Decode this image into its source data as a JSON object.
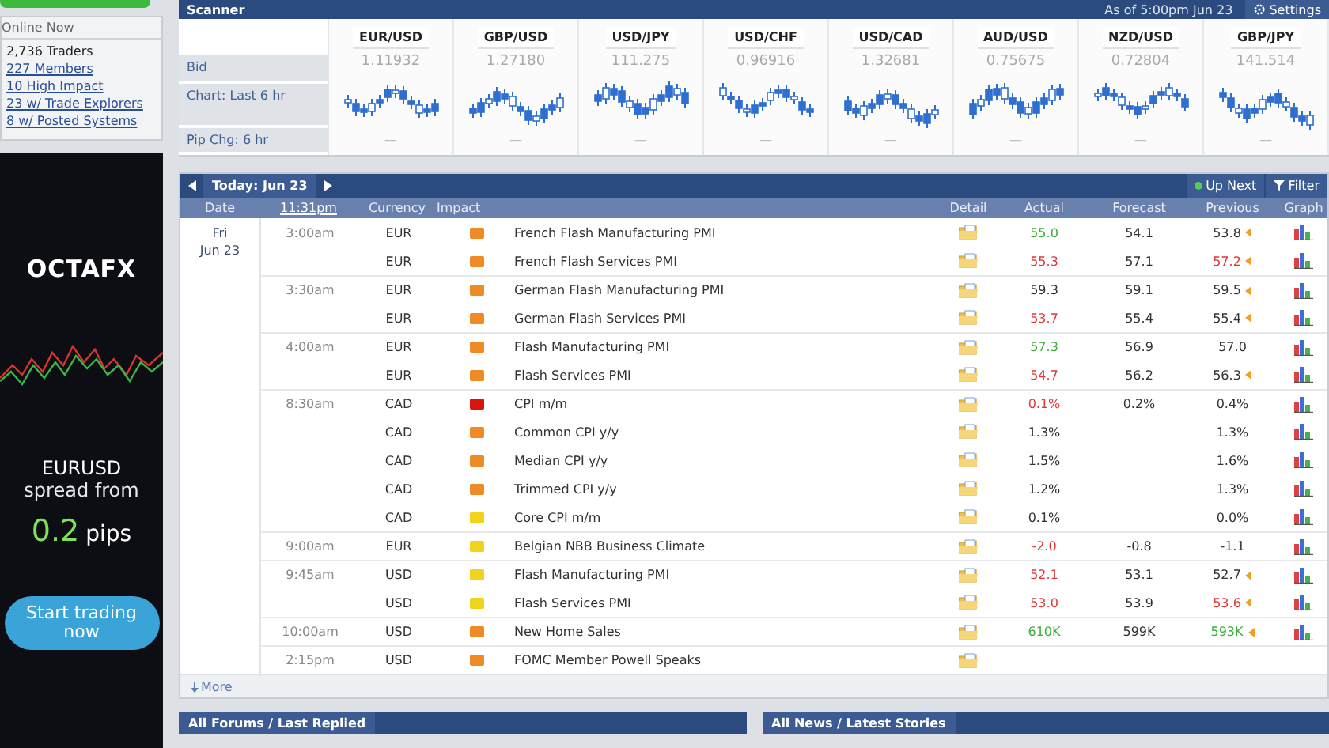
{
  "online_now": {
    "title": "Online Now",
    "items": [
      {
        "kind": "text",
        "label": "2,736 Traders"
      },
      {
        "kind": "link",
        "label": "227 Members"
      },
      {
        "kind": "link",
        "label": "10 High Impact"
      },
      {
        "kind": "link",
        "label": "23 w/ Trade Explorers"
      },
      {
        "kind": "link",
        "label": "8 w/ Posted Systems"
      }
    ]
  },
  "ad": {
    "logo": "OCTAFX",
    "pair": "EURUSD",
    "line": "spread from",
    "value": "0.2",
    "unit": "pips",
    "button": "Start trading now"
  },
  "scanner": {
    "title": "Scanner",
    "as_of": "As of 5:00pm Jun 23",
    "settings": "Settings",
    "row_labels": [
      "Bid",
      "Chart: Last 6 hr",
      "Pip Chg: 6 hr"
    ],
    "pairs": [
      {
        "name": "EUR/USD",
        "bid": "1.11932",
        "pip_chg": "—"
      },
      {
        "name": "GBP/USD",
        "bid": "1.27180",
        "pip_chg": "—"
      },
      {
        "name": "USD/JPY",
        "bid": "111.275",
        "pip_chg": "—"
      },
      {
        "name": "USD/CHF",
        "bid": "0.96916",
        "pip_chg": "—"
      },
      {
        "name": "USD/CAD",
        "bid": "1.32681",
        "pip_chg": "—"
      },
      {
        "name": "AUD/USD",
        "bid": "0.75675",
        "pip_chg": "—"
      },
      {
        "name": "NZD/USD",
        "bid": "0.72804",
        "pip_chg": "—"
      },
      {
        "name": "GBP/JPY",
        "bid": "141.514",
        "pip_chg": "—"
      }
    ]
  },
  "calendar": {
    "today": "Today: Jun 23",
    "up_next": "Up Next",
    "filter": "Filter",
    "columns": [
      "Date",
      "11:31pm",
      "Currency",
      "Impact",
      "Detail",
      "Actual",
      "Forecast",
      "Previous",
      "Graph"
    ],
    "day": "Fri",
    "date": "Jun 23",
    "rows": [
      {
        "time": "3:00am",
        "currency": "EUR",
        "impact": {
          "color": "#f08a24"
        },
        "event": "French Flash Manufacturing PMI",
        "actual": {
          "text": "55.0",
          "color": "#3ab03a"
        },
        "forecast": "54.1",
        "previous": {
          "text": "53.8",
          "color": "#333333"
        },
        "revised": true,
        "graph": true
      },
      {
        "time": "",
        "currency": "EUR",
        "impact": {
          "color": "#f08a24"
        },
        "event": "French Flash Services PMI",
        "actual": {
          "text": "55.3",
          "color": "#e03838"
        },
        "forecast": "57.1",
        "previous": {
          "text": "57.2",
          "color": "#e03838"
        },
        "revised": true,
        "graph": true
      },
      {
        "time": "3:30am",
        "currency": "EUR",
        "impact": {
          "color": "#f08a24"
        },
        "event": "German Flash Manufacturing PMI",
        "actual": {
          "text": "59.3",
          "color": "#333333"
        },
        "forecast": "59.1",
        "previous": {
          "text": "59.5",
          "color": "#333333"
        },
        "revised": true,
        "graph": true
      },
      {
        "time": "",
        "currency": "EUR",
        "impact": {
          "color": "#f08a24"
        },
        "event": "German Flash Services PMI",
        "actual": {
          "text": "53.7",
          "color": "#e03838"
        },
        "forecast": "55.4",
        "previous": {
          "text": "55.4",
          "color": "#333333"
        },
        "revised": true,
        "graph": true
      },
      {
        "time": "4:00am",
        "currency": "EUR",
        "impact": {
          "color": "#f08a24"
        },
        "event": "Flash Manufacturing PMI",
        "actual": {
          "text": "57.3",
          "color": "#3ab03a"
        },
        "forecast": "56.9",
        "previous": {
          "text": "57.0",
          "color": "#333333"
        },
        "revised": false,
        "graph": true
      },
      {
        "time": "",
        "currency": "EUR",
        "impact": {
          "color": "#f08a24"
        },
        "event": "Flash Services PMI",
        "actual": {
          "text": "54.7",
          "color": "#e03838"
        },
        "forecast": "56.2",
        "previous": {
          "text": "56.3",
          "color": "#333333"
        },
        "revised": true,
        "graph": true
      },
      {
        "time": "8:30am",
        "currency": "CAD",
        "impact": {
          "color": "#d9140f"
        },
        "event": "CPI m/m",
        "actual": {
          "text": "0.1%",
          "color": "#e03838"
        },
        "forecast": "0.2%",
        "previous": {
          "text": "0.4%",
          "color": "#333333"
        },
        "revised": false,
        "graph": true
      },
      {
        "time": "",
        "currency": "CAD",
        "impact": {
          "color": "#f08a24"
        },
        "event": "Common CPI y/y",
        "actual": {
          "text": "1.3%",
          "color": "#333333"
        },
        "forecast": "",
        "previous": {
          "text": "1.3%",
          "color": "#333333"
        },
        "revised": false,
        "graph": true
      },
      {
        "time": "",
        "currency": "CAD",
        "impact": {
          "color": "#f08a24"
        },
        "event": "Median CPI y/y",
        "actual": {
          "text": "1.5%",
          "color": "#333333"
        },
        "forecast": "",
        "previous": {
          "text": "1.6%",
          "color": "#333333"
        },
        "revised": false,
        "graph": true
      },
      {
        "time": "",
        "currency": "CAD",
        "impact": {
          "color": "#f08a24"
        },
        "event": "Trimmed CPI y/y",
        "actual": {
          "text": "1.2%",
          "color": "#333333"
        },
        "forecast": "",
        "previous": {
          "text": "1.3%",
          "color": "#333333"
        },
        "revised": false,
        "graph": true
      },
      {
        "time": "",
        "currency": "CAD",
        "impact": {
          "color": "#f2d31b"
        },
        "event": "Core CPI m/m",
        "actual": {
          "text": "0.1%",
          "color": "#333333"
        },
        "forecast": "",
        "previous": {
          "text": "0.0%",
          "color": "#333333"
        },
        "revised": false,
        "graph": true
      },
      {
        "time": "9:00am",
        "currency": "EUR",
        "impact": {
          "color": "#f2d31b"
        },
        "event": "Belgian NBB Business Climate",
        "actual": {
          "text": "-2.0",
          "color": "#e03838"
        },
        "forecast": "-0.8",
        "previous": {
          "text": "-1.1",
          "color": "#333333"
        },
        "revised": false,
        "graph": true
      },
      {
        "time": "9:45am",
        "currency": "USD",
        "impact": {
          "color": "#f2d31b"
        },
        "event": "Flash Manufacturing PMI",
        "actual": {
          "text": "52.1",
          "color": "#e03838"
        },
        "forecast": "53.1",
        "previous": {
          "text": "52.7",
          "color": "#333333"
        },
        "revised": true,
        "graph": true
      },
      {
        "time": "",
        "currency": "USD",
        "impact": {
          "color": "#f2d31b"
        },
        "event": "Flash Services PMI",
        "actual": {
          "text": "53.0",
          "color": "#e03838"
        },
        "forecast": "53.9",
        "previous": {
          "text": "53.6",
          "color": "#e03838"
        },
        "revised": true,
        "graph": true
      },
      {
        "time": "10:00am",
        "currency": "USD",
        "impact": {
          "color": "#f08a24"
        },
        "event": "New Home Sales",
        "actual": {
          "text": "610K",
          "color": "#3ab03a"
        },
        "forecast": "599K",
        "previous": {
          "text": "593K",
          "color": "#3ab03a"
        },
        "revised": true,
        "graph": true
      },
      {
        "time": "2:15pm",
        "currency": "USD",
        "impact": {
          "color": "#f08a24"
        },
        "event": "FOMC Member Powell Speaks",
        "revised": false,
        "graph": false
      }
    ],
    "more": "More"
  },
  "bottom_panels": [
    "All Forums / Last Replied",
    "All News / Latest Stories"
  ]
}
